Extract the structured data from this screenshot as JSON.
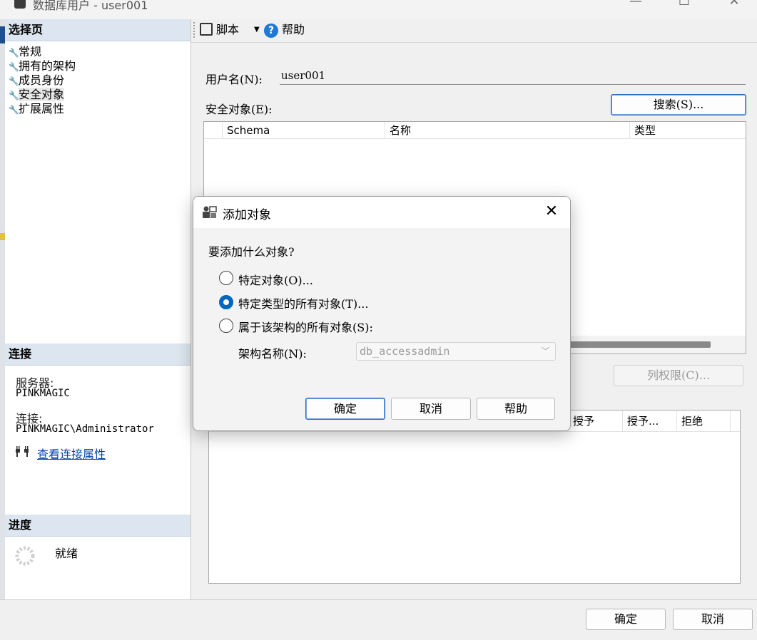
{
  "window": {
    "title": "数据库用户 - user001",
    "minimize_glyph": "—",
    "maximize_glyph": "☐",
    "close_glyph": "✕"
  },
  "left_panel": {
    "select_page_header": "选择页",
    "pages": [
      {
        "label": "常规",
        "icon": "wrench-icon"
      },
      {
        "label": "拥有的架构",
        "icon": "wrench-icon"
      },
      {
        "label": "成员身份",
        "icon": "wrench-icon"
      },
      {
        "label": "安全对象",
        "icon": "wrench-icon",
        "active": true
      },
      {
        "label": "扩展属性",
        "icon": "wrench-icon"
      }
    ],
    "connection_header": "连接",
    "server_label": "服务器:",
    "server_value": "PINKMAGIC",
    "connection_label": "连接:",
    "connection_value": "PINKMAGIC\\Administrator",
    "view_connection_link": "查看连接属性",
    "progress_header": "进度",
    "progress_status": "就绪"
  },
  "toolbar": {
    "script_label": "脚本",
    "help_label": "帮助"
  },
  "main": {
    "username_label": "用户名(N):",
    "username_value": "user001",
    "securables_label": "安全对象(E):",
    "search_button": "搜索(S)...",
    "securables_columns": [
      "Schema",
      "名称",
      "类型"
    ],
    "column_permissions_button": "列权限(C)...",
    "permissions_columns": [
      "授予",
      "授予...",
      "拒绝"
    ]
  },
  "bottom": {
    "ok_button": "确定",
    "cancel_button": "取消"
  },
  "dialog": {
    "title": "添加对象",
    "prompt": "要添加什么对象?",
    "options": [
      {
        "label": "特定对象(O)...",
        "checked": false
      },
      {
        "label": "特定类型的所有对象(T)...",
        "checked": true
      },
      {
        "label": "属于该架构的所有对象(S):",
        "checked": false
      }
    ],
    "schema_name_label": "架构名称(N):",
    "schema_name_value": "db_accessadmin",
    "ok_button": "确定",
    "cancel_button": "取消",
    "help_button": "帮助"
  },
  "colors": {
    "accent": "#0067c0",
    "section_header_bg": "#dde6f0",
    "link": "#0645ad"
  }
}
